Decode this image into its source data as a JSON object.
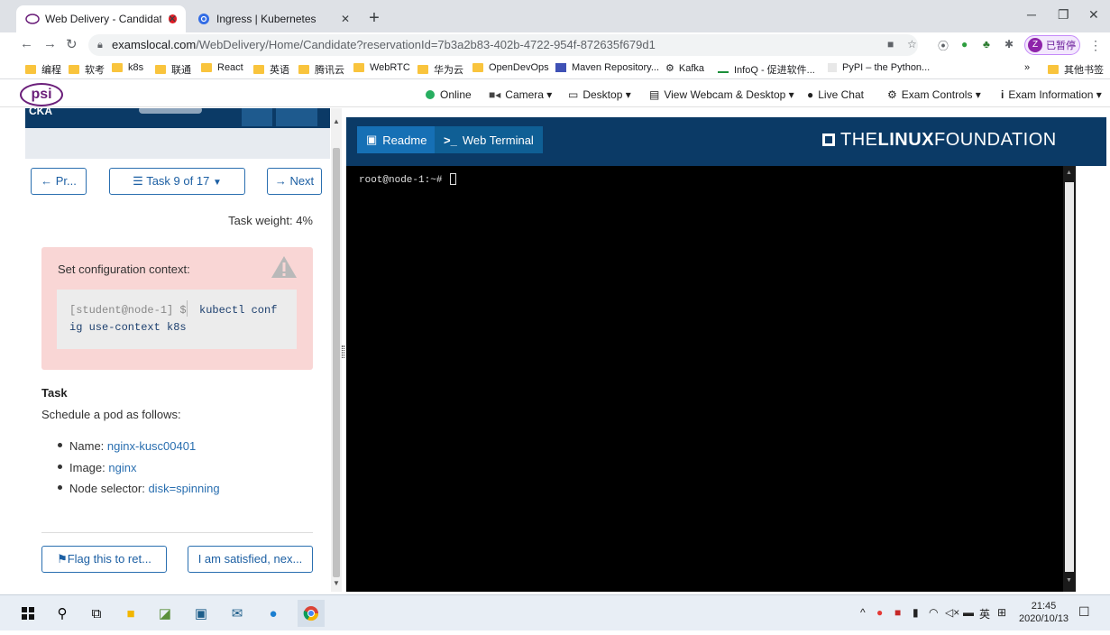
{
  "browser": {
    "tabs": [
      {
        "label": "Web Delivery - Candidate",
        "active": true
      },
      {
        "label": "Ingress | Kubernetes",
        "active": false
      }
    ],
    "new_tab": "+",
    "url_host": "examslocal.com",
    "url_path": "/WebDelivery/Home/Candidate?reservationId=7b3a2b83-402b-4722-954f-872635f679d1",
    "profile_initial": "Z",
    "profile_label": "已暂停",
    "bookmarks": [
      "编程",
      "软考",
      "k8s",
      "联通",
      "React",
      "英语",
      "腾讯云",
      "WebRTC",
      "华为云",
      "OpenDevOps",
      "Maven Repository...",
      "Kafka",
      "InfoQ - 促进软件...",
      "PyPI – the Python..."
    ],
    "bookmarks_more": "»",
    "bookmarks_other": "其他书签"
  },
  "psi_header": {
    "logo": "psi",
    "online": "Online",
    "camera": "Camera",
    "desktop": "Desktop",
    "webcam_desktop": "View Webcam & Desktop",
    "live_chat": "Live Chat",
    "exam_controls": "Exam Controls",
    "exam_info": "Exam Information"
  },
  "left": {
    "header_title": "CKA",
    "prev": "Pr...",
    "task_selector": "Task 9 of 17",
    "next": "Next",
    "weight": "Task weight: 4%",
    "alert_title": "Set configuration context:",
    "prompt": "[student@node-1] $",
    "command_line1": "kubectl conf",
    "command_line2": "ig use-context k8s",
    "task_heading": "Task",
    "task_description": "Schedule a pod as follows:",
    "requirements": [
      {
        "label": "Name:",
        "value": "nginx-kusc00401"
      },
      {
        "label": "Image:",
        "value": "nginx"
      },
      {
        "label": "Node selector:",
        "value": "disk=spinning"
      }
    ],
    "flag_button": "Flag this to ret...",
    "satisfied_button": "I am satisfied, nex..."
  },
  "right": {
    "tab_readme": "Readme",
    "tab_terminal": "Web Terminal",
    "brand_the": "THE",
    "brand_linux": "LINUX",
    "brand_foundation": "FOUNDATION",
    "terminal_line": "root@node-1:~#"
  },
  "taskbar": {
    "lang": "英",
    "time": "21:45",
    "date": "2020/10/13"
  },
  "colors": {
    "navy": "#0b3a66",
    "alert_bg": "#f9d6d5",
    "link": "#2a6fb0",
    "psi_purple": "#6b1f7a"
  }
}
